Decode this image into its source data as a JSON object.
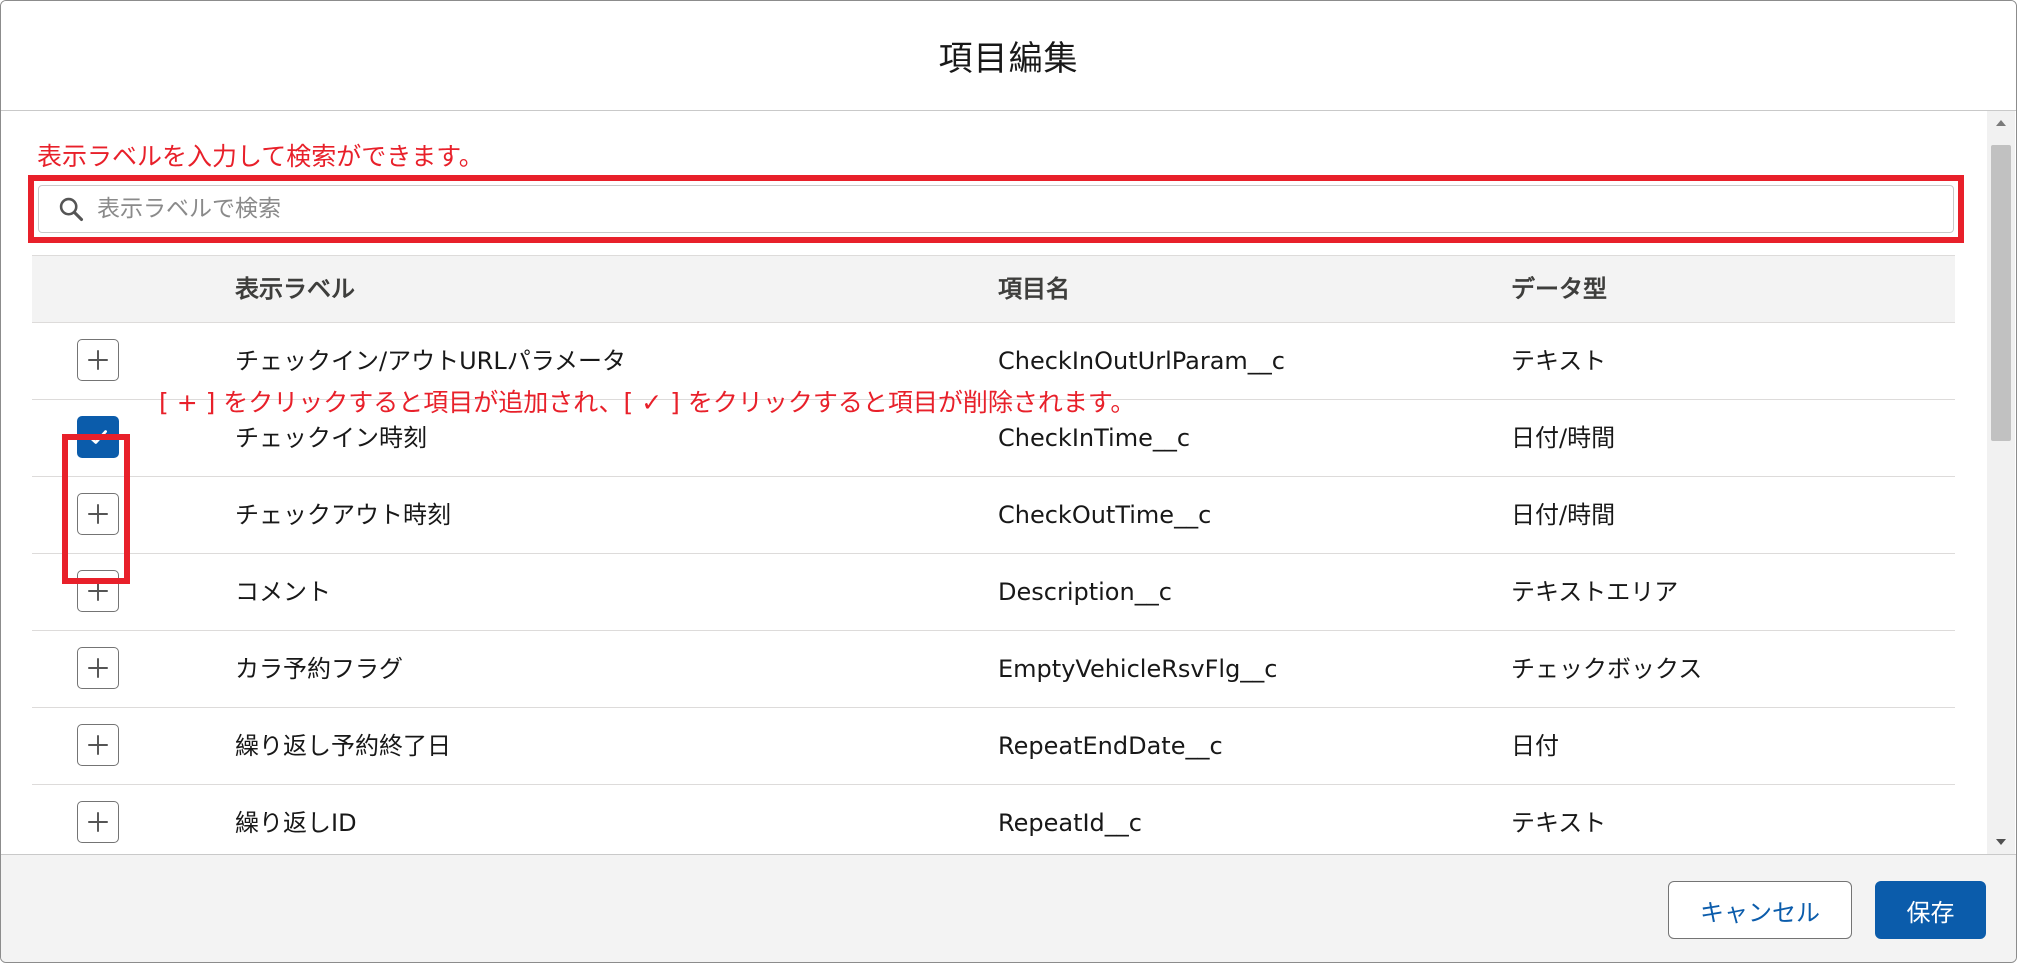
{
  "modal": {
    "title": "項目編集"
  },
  "annotations": {
    "search_hint": "表示ラベルを入力して検索ができます。",
    "toggle_hint": "[ + ] をクリックすると項目が追加され、[ ✓ ] をクリックすると項目が削除されます。"
  },
  "search": {
    "placeholder": "表示ラベルで検索",
    "value": "",
    "icon": "search-icon"
  },
  "table": {
    "headers": {
      "label": "表示ラベル",
      "api": "項目名",
      "type": "データ型"
    },
    "rows": [
      {
        "label": "チェックイン/アウトURLパラメータ",
        "api": "CheckInOutUrlParam__c",
        "type": "テキスト",
        "selected": false
      },
      {
        "label": "チェックイン時刻",
        "api": "CheckInTime__c",
        "type": "日付/時間",
        "selected": true
      },
      {
        "label": "チェックアウト時刻",
        "api": "CheckOutTime__c",
        "type": "日付/時間",
        "selected": false
      },
      {
        "label": "コメント",
        "api": "Description__c",
        "type": "テキストエリア",
        "selected": false
      },
      {
        "label": "カラ予約フラグ",
        "api": "EmptyVehicleRsvFlg__c",
        "type": "チェックボックス",
        "selected": false
      },
      {
        "label": "繰り返し予約終了日",
        "api": "RepeatEndDate__c",
        "type": "日付",
        "selected": false
      },
      {
        "label": "繰り返しID",
        "api": "RepeatId__c",
        "type": "テキスト",
        "selected": false
      }
    ]
  },
  "footer": {
    "cancel_label": "キャンセル",
    "save_label": "保存"
  },
  "colors": {
    "brand": "#0b5cab",
    "annotation": "#e8202a",
    "header_bg": "#f3f3f3"
  }
}
